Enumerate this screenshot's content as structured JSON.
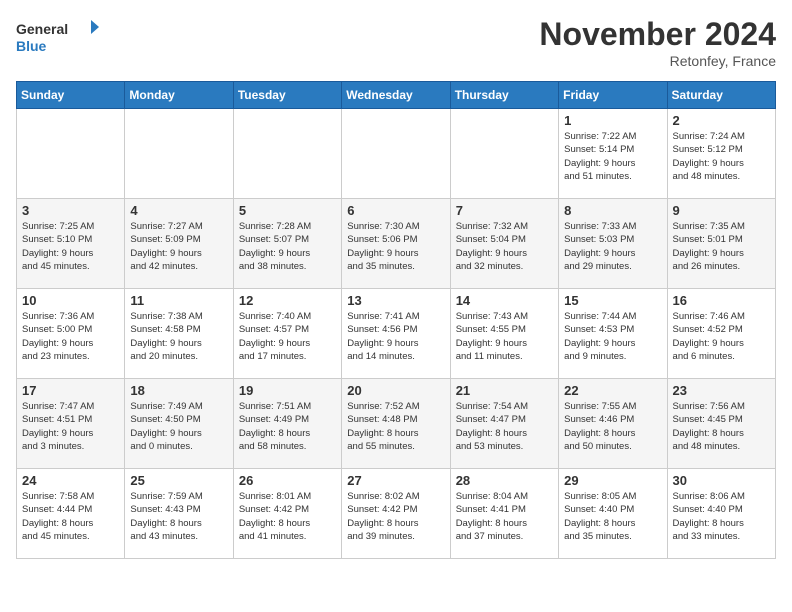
{
  "header": {
    "logo_line1": "General",
    "logo_line2": "Blue",
    "month": "November 2024",
    "location": "Retonfey, France"
  },
  "weekdays": [
    "Sunday",
    "Monday",
    "Tuesday",
    "Wednesday",
    "Thursday",
    "Friday",
    "Saturday"
  ],
  "days": [
    {
      "date": "",
      "info": ""
    },
    {
      "date": "",
      "info": ""
    },
    {
      "date": "",
      "info": ""
    },
    {
      "date": "",
      "info": ""
    },
    {
      "date": "",
      "info": ""
    },
    {
      "date": "1",
      "info": "Sunrise: 7:22 AM\nSunset: 5:14 PM\nDaylight: 9 hours\nand 51 minutes."
    },
    {
      "date": "2",
      "info": "Sunrise: 7:24 AM\nSunset: 5:12 PM\nDaylight: 9 hours\nand 48 minutes."
    },
    {
      "date": "3",
      "info": "Sunrise: 7:25 AM\nSunset: 5:10 PM\nDaylight: 9 hours\nand 45 minutes."
    },
    {
      "date": "4",
      "info": "Sunrise: 7:27 AM\nSunset: 5:09 PM\nDaylight: 9 hours\nand 42 minutes."
    },
    {
      "date": "5",
      "info": "Sunrise: 7:28 AM\nSunset: 5:07 PM\nDaylight: 9 hours\nand 38 minutes."
    },
    {
      "date": "6",
      "info": "Sunrise: 7:30 AM\nSunset: 5:06 PM\nDaylight: 9 hours\nand 35 minutes."
    },
    {
      "date": "7",
      "info": "Sunrise: 7:32 AM\nSunset: 5:04 PM\nDaylight: 9 hours\nand 32 minutes."
    },
    {
      "date": "8",
      "info": "Sunrise: 7:33 AM\nSunset: 5:03 PM\nDaylight: 9 hours\nand 29 minutes."
    },
    {
      "date": "9",
      "info": "Sunrise: 7:35 AM\nSunset: 5:01 PM\nDaylight: 9 hours\nand 26 minutes."
    },
    {
      "date": "10",
      "info": "Sunrise: 7:36 AM\nSunset: 5:00 PM\nDaylight: 9 hours\nand 23 minutes."
    },
    {
      "date": "11",
      "info": "Sunrise: 7:38 AM\nSunset: 4:58 PM\nDaylight: 9 hours\nand 20 minutes."
    },
    {
      "date": "12",
      "info": "Sunrise: 7:40 AM\nSunset: 4:57 PM\nDaylight: 9 hours\nand 17 minutes."
    },
    {
      "date": "13",
      "info": "Sunrise: 7:41 AM\nSunset: 4:56 PM\nDaylight: 9 hours\nand 14 minutes."
    },
    {
      "date": "14",
      "info": "Sunrise: 7:43 AM\nSunset: 4:55 PM\nDaylight: 9 hours\nand 11 minutes."
    },
    {
      "date": "15",
      "info": "Sunrise: 7:44 AM\nSunset: 4:53 PM\nDaylight: 9 hours\nand 9 minutes."
    },
    {
      "date": "16",
      "info": "Sunrise: 7:46 AM\nSunset: 4:52 PM\nDaylight: 9 hours\nand 6 minutes."
    },
    {
      "date": "17",
      "info": "Sunrise: 7:47 AM\nSunset: 4:51 PM\nDaylight: 9 hours\nand 3 minutes."
    },
    {
      "date": "18",
      "info": "Sunrise: 7:49 AM\nSunset: 4:50 PM\nDaylight: 9 hours\nand 0 minutes."
    },
    {
      "date": "19",
      "info": "Sunrise: 7:51 AM\nSunset: 4:49 PM\nDaylight: 8 hours\nand 58 minutes."
    },
    {
      "date": "20",
      "info": "Sunrise: 7:52 AM\nSunset: 4:48 PM\nDaylight: 8 hours\nand 55 minutes."
    },
    {
      "date": "21",
      "info": "Sunrise: 7:54 AM\nSunset: 4:47 PM\nDaylight: 8 hours\nand 53 minutes."
    },
    {
      "date": "22",
      "info": "Sunrise: 7:55 AM\nSunset: 4:46 PM\nDaylight: 8 hours\nand 50 minutes."
    },
    {
      "date": "23",
      "info": "Sunrise: 7:56 AM\nSunset: 4:45 PM\nDaylight: 8 hours\nand 48 minutes."
    },
    {
      "date": "24",
      "info": "Sunrise: 7:58 AM\nSunset: 4:44 PM\nDaylight: 8 hours\nand 45 minutes."
    },
    {
      "date": "25",
      "info": "Sunrise: 7:59 AM\nSunset: 4:43 PM\nDaylight: 8 hours\nand 43 minutes."
    },
    {
      "date": "26",
      "info": "Sunrise: 8:01 AM\nSunset: 4:42 PM\nDaylight: 8 hours\nand 41 minutes."
    },
    {
      "date": "27",
      "info": "Sunrise: 8:02 AM\nSunset: 4:42 PM\nDaylight: 8 hours\nand 39 minutes."
    },
    {
      "date": "28",
      "info": "Sunrise: 8:04 AM\nSunset: 4:41 PM\nDaylight: 8 hours\nand 37 minutes."
    },
    {
      "date": "29",
      "info": "Sunrise: 8:05 AM\nSunset: 4:40 PM\nDaylight: 8 hours\nand 35 minutes."
    },
    {
      "date": "30",
      "info": "Sunrise: 8:06 AM\nSunset: 4:40 PM\nDaylight: 8 hours\nand 33 minutes."
    }
  ]
}
